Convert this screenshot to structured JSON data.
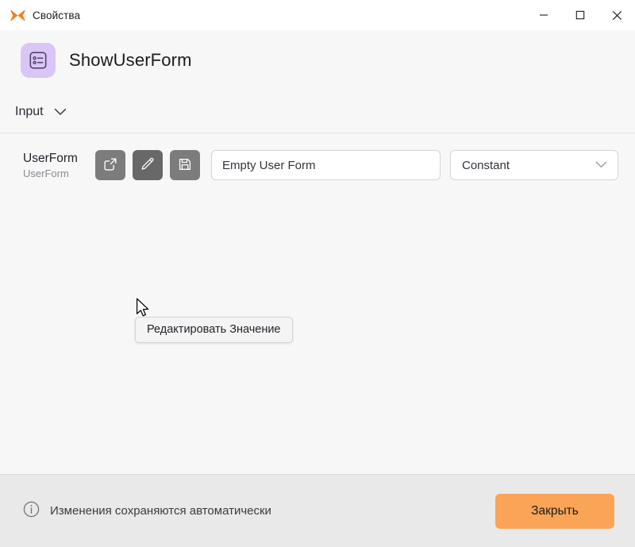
{
  "window": {
    "title": "Свойства",
    "app_icon": "butterfly-icon",
    "controls": {
      "minimize": "minimize-icon",
      "maximize": "maximize-icon",
      "close": "close-icon"
    }
  },
  "header": {
    "icon": "form-icon",
    "title": "ShowUserForm"
  },
  "section": {
    "label": "Input",
    "chevron": "chevron-down-icon"
  },
  "property": {
    "name": "UserForm",
    "type": "UserForm",
    "buttons": [
      {
        "name": "open-external-button",
        "icon": "external-link-icon",
        "hovered": false
      },
      {
        "name": "edit-value-button",
        "icon": "pencil-icon",
        "hovered": true
      },
      {
        "name": "save-value-button",
        "icon": "floppy-disk-icon",
        "hovered": false
      }
    ],
    "value": "Empty User Form",
    "value_placeholder": "",
    "mode": "Constant",
    "mode_chevron": "chevron-down-icon"
  },
  "tooltip": {
    "text": "Редактировать Значение"
  },
  "footer": {
    "info_icon": "info-circle-icon",
    "note": "Изменения сохраняются автоматически",
    "close_label": "Закрыть"
  },
  "colors": {
    "accent_orange": "#f9a457",
    "brand_orange": "#ef8023",
    "icon_purple_bg": "#d9c6f7",
    "icon_purple_fg": "#4c3b66",
    "button_gray": "#7c7c7c",
    "button_gray_hover": "#686868",
    "body_bg": "#f7f7f7",
    "footer_bg": "#e9e9e9",
    "titlebar_bg": "#ffffff"
  }
}
